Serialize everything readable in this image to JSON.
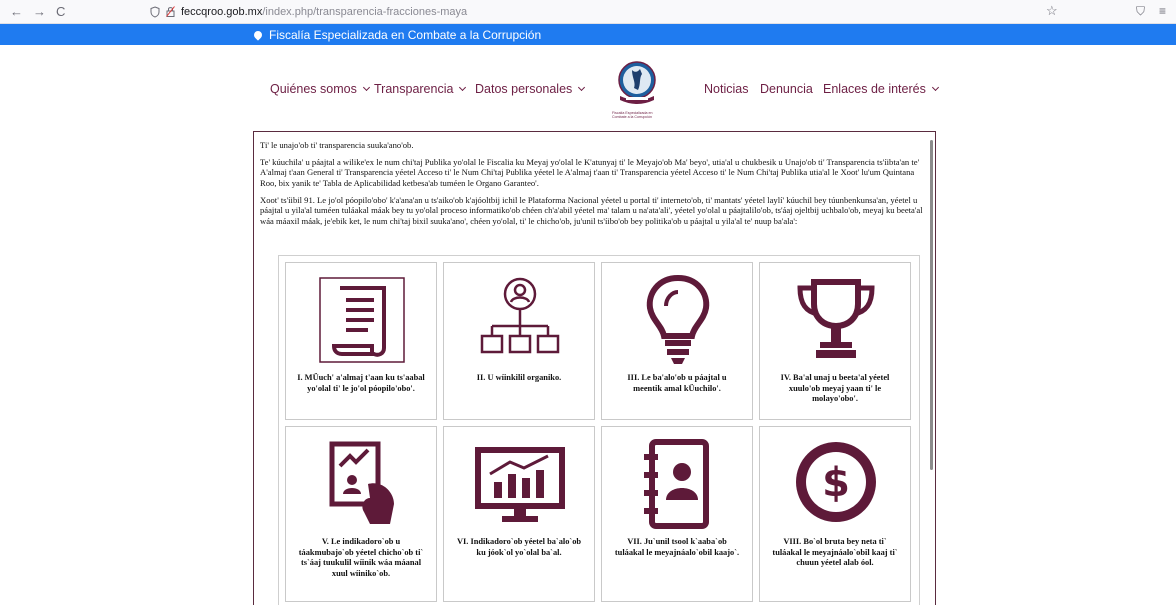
{
  "browser": {
    "back": "←",
    "forward": "→",
    "reload": "C",
    "url_host": "feccqroo.gob.mx",
    "url_path": "/index.php/transparencia-fracciones-maya",
    "bookmark": "☆",
    "pocket": "⛉",
    "menu": "≡"
  },
  "banner": {
    "text": "Fiscalía Especializada en Combate a la Corrupción"
  },
  "menu": {
    "quienes": "Quiénes somos",
    "transparencia": "Transparencia",
    "datos": "Datos personales",
    "noticias": "Noticias",
    "denuncia": "Denuncia",
    "enlaces": "Enlaces de interés",
    "logo_caption": "Fiscalía Especializada en Combate a la Corrupción"
  },
  "content": {
    "p1": "Ti' le unajo'ob ti' transparencia suuka'ano'ob.",
    "p2": "Te' kúuchila' u páajtal a wilike'ex le num chi'taj Publika yo'olal le Fiscalia ku Meyaj yo'olal le K'atunyaj ti' le Meyajo'ob Ma' beyo', utia'al u chukbesik u Unajo'ob ti' Transparencia ts'íibta'an te' A'almaj t'aan General ti' Transparencia yéetel Acceso ti' le Num Chi'taj Publika yéetel le A'almaj t'aan ti' Transparencia yéetel Acceso ti' le Num Chi'taj Publika utia'al le Xoot' lu'um Quintana Roo, bix yanik te' Tabla de Aplicabilidad ketbesa'ab tuméen le Organo Garanteo'.",
    "p3": "Xoot' ts'íibil 91. Le jo'ol póopilo'obo' k'a'ana'an u ts'aiko'ob k'ajóoltbij ichil le Plataforma Nacional yéetel u portal ti' interneto'ob, ti' mantats' yéetel laylí' kúuchil bey túunbenkunsa'an, yéetel u páajtal u yila'al tuméen tuláakal máak bey tu yo'olal proceso informatiko'ob chéen ch'a'abil yéetel ma' talam u na'ata'ali', yéetel yo'olal u páajtalilo'ob, ts'áaj ojeltbij uchbalo'ob, meyaj ku beeta'al wáa máaxil máak, je'ebik ket, le num chi'taj bixil suuka'ano', chéen yo'olal, ti' le chicho'ob, ju'unil ts'íibo'ob bey politika'ob u páajtal u yila'al te' nuup ba'ala':"
  },
  "cards": [
    {
      "icon": "scroll-document-icon",
      "label": "I. MÜuch' a'almaj t'aan ku ts'aabal yo'olal ti' le jo'ol póopilo'obo'."
    },
    {
      "icon": "org-chart-icon",
      "label": "II. U wíinkilil organiko."
    },
    {
      "icon": "light-bulb-icon",
      "label": "III. Le ba'alo'ob u páajtal u meentik amal kÜuchilo'."
    },
    {
      "icon": "trophy-icon",
      "label": "IV. Ba'al unaj u beeta'al yéetel xuulo'ob meyaj yaan ti' le molayo'obo'."
    },
    {
      "icon": "indicator-report-icon",
      "label": "V. Le indikadoro`ob u táakmubajo`ob yéetel chicho`ob ti` ts`áaj tuukulil wíinik wáa máanal xuul wíiniko`ob."
    },
    {
      "icon": "monitor-chart-icon",
      "label": "VI. Indikadoro`ob yéetel ba`alo`ob ku jóok`ol yo`olal ba`al."
    },
    {
      "icon": "contact-directory-icon",
      "label": "VII. Ju`unil tsool k`aaba`ob tuláakal le meyajnáalo`obil kaajo`."
    },
    {
      "icon": "dollar-coin-icon",
      "label": "VIII. Bo`ol bruta bey neta ti` tuláakal le meyajnáalo`obil kaaj ti` chuun yéetel alab óol."
    }
  ],
  "colors": {
    "accent": "#6d1f44",
    "banner": "#1f7bf0",
    "icon": "#5e1a39"
  }
}
